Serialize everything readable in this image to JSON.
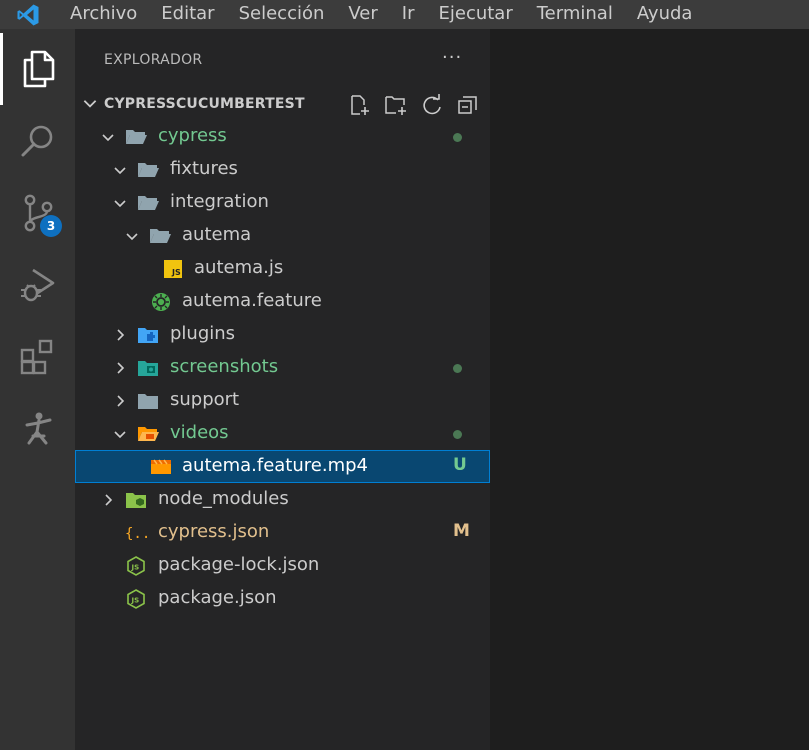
{
  "menu": [
    "Archivo",
    "Editar",
    "Selección",
    "Ver",
    "Ir",
    "Ejecutar",
    "Terminal",
    "Ayuda"
  ],
  "activity_bar": {
    "items": [
      "explorer-icon",
      "search-icon",
      "source-control-icon",
      "run-debug-icon",
      "extensions-icon",
      "cypress-icon"
    ],
    "scm_badge": "3"
  },
  "sidebar": {
    "title": "EXPLORADOR",
    "more": "···",
    "section_title": "CYPRESSCUCUMBERTEST",
    "tree": [
      {
        "label": "cypress",
        "status": "",
        "color": "#73c991"
      },
      {
        "label": "fixtures",
        "status": "",
        "color": "#cccccc"
      },
      {
        "label": "integration",
        "status": "",
        "color": "#cccccc"
      },
      {
        "label": "autema",
        "status": "",
        "color": "#cccccc"
      },
      {
        "label": "autema.js",
        "status": "",
        "color": "#cccccc"
      },
      {
        "label": "autema.feature",
        "status": "",
        "color": "#cccccc"
      },
      {
        "label": "plugins",
        "status": "",
        "color": "#cccccc"
      },
      {
        "label": "screenshots",
        "status": "",
        "color": "#73c991"
      },
      {
        "label": "support",
        "status": "",
        "color": "#cccccc"
      },
      {
        "label": "videos",
        "status": "",
        "color": "#73c991"
      },
      {
        "label": "autema.feature.mp4",
        "status": "U",
        "color": "#73c991"
      },
      {
        "label": "node_modules",
        "status": "",
        "color": "#cccccc"
      },
      {
        "label": "cypress.json",
        "status": "M",
        "color": "#e2c08d"
      },
      {
        "label": "package-lock.json",
        "status": "",
        "color": "#cccccc"
      },
      {
        "label": "package.json",
        "status": "",
        "color": "#cccccc"
      }
    ]
  },
  "colors": {
    "untracked": "#73c991",
    "modified": "#e2c08d",
    "selection": "#094771",
    "accent": "#0e70c0"
  }
}
